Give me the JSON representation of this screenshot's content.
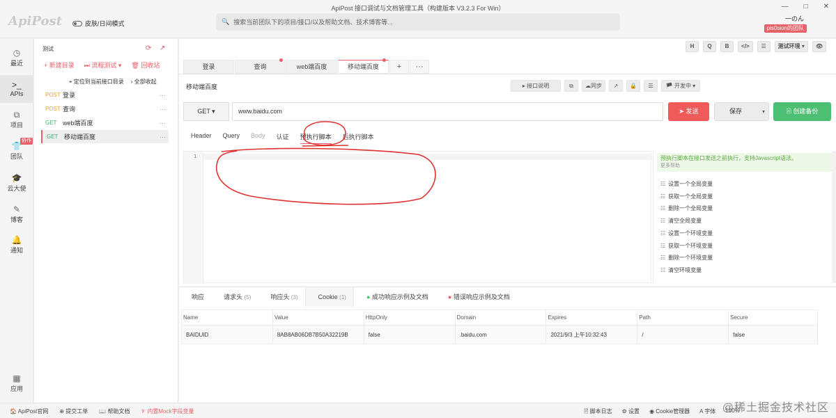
{
  "window": {
    "logo": "ApiPost",
    "theme_toggle": "皮肤/日间模式",
    "title": "ApiPost 接口调试与文档管理工具（构建版本 V3.2.3 For Win）",
    "search_placeholder": "搜索当前团队下的项目/接口/以及帮助文档、技术博客等...",
    "minimize": "—",
    "maximize": "□",
    "close": "✕",
    "user_name": "一のん",
    "team_badge": "pis0sion的团队"
  },
  "nav": {
    "items": [
      {
        "label": "最近",
        "icon": "◷"
      },
      {
        "label": "APIs",
        "icon": ">_"
      },
      {
        "label": "项目",
        "icon": "⧉"
      },
      {
        "label": "团队",
        "icon": "👕"
      },
      {
        "label": "云大使",
        "icon": "🎓"
      },
      {
        "label": "博客",
        "icon": "✎"
      },
      {
        "label": "通知",
        "icon": "🔔"
      },
      {
        "label": "应用",
        "icon": "▦"
      }
    ],
    "collab_badge": "协作"
  },
  "tree": {
    "project": "测试",
    "new_dir": "+ 新建目录",
    "flow_test": "⏭ 流程测试 ▾",
    "recycle": "🗑 回收站",
    "locate": "⌖ 定位到当前接口目录",
    "collapse_all": "› 全部收起",
    "rows": [
      {
        "method": "POST",
        "name": "登录"
      },
      {
        "method": "POST",
        "name": "查询"
      },
      {
        "method": "GET",
        "name": "web端百度"
      },
      {
        "method": "GET",
        "name": "移动端百度"
      }
    ]
  },
  "toolbar": {
    "tools": [
      "H",
      "Q",
      "B",
      "</>",
      "☰",
      "测试环境 ▾",
      "👁"
    ]
  },
  "tabs": {
    "items": [
      "登录",
      "查询",
      "web端百度",
      "移动端百度"
    ],
    "plus": "+",
    "more": "···"
  },
  "api": {
    "title": "移动端百度",
    "doc_btn": "▸ 接口说明",
    "copy_btn": "⧉",
    "sync_btn": "☁同步",
    "share_btn": "↗",
    "lock_btn": "🔒",
    "db_btn": "☰",
    "status_btn": "🏴 开发中 ▾",
    "method": "GET ▾",
    "url": "www.baidu.com",
    "send": "➤ 发送",
    "save": "保存",
    "save_caret": "▾",
    "backup": "🗎 创建备份"
  },
  "subtabs": [
    "Header",
    "Query",
    "Body",
    "认证",
    "预执行脚本",
    "后执行脚本"
  ],
  "editor": {
    "line_number": "1"
  },
  "hints": {
    "desc": "预执行脚本在接口发送之前执行，支持Javascript语法。",
    "more": "更多帮助",
    "snippets": [
      "设置一个全局变量",
      "获取一个全局变量",
      "删除一个全局变量",
      "清空全局变量",
      "设置一个环境变量",
      "获取一个环境变量",
      "删除一个环境变量",
      "清空环境变量"
    ]
  },
  "response": {
    "tabs": [
      {
        "label": "响应",
        "count": ""
      },
      {
        "label": "请求头",
        "count": "(5)"
      },
      {
        "label": "响应头",
        "count": "(3)"
      },
      {
        "label": "Cookie",
        "count": "(1)"
      },
      {
        "label": "成功响应示例及文档",
        "count": ""
      },
      {
        "label": "错误响应示例及文档",
        "count": ""
      }
    ],
    "columns": [
      "Name",
      "Value",
      "HttpOnly",
      "Domain",
      "Expires",
      "Path",
      "Secure"
    ],
    "rows": [
      [
        "BAIDUID",
        "8AB8AB06DB7B50A32219B",
        "false",
        ".baidu.com",
        "2021/9/3 上午10:32:43",
        "/",
        "false"
      ]
    ]
  },
  "status": {
    "left": [
      "ApiPost官网",
      "提交工单",
      "帮助文档"
    ],
    "mock": "内置Mock字段变量",
    "right": [
      "🗎 脚本日志",
      "⚙ 设置",
      "◉ Cookie管理器",
      "A 字体",
      "100%"
    ]
  },
  "watermark": "@稀土掘金技术社区"
}
